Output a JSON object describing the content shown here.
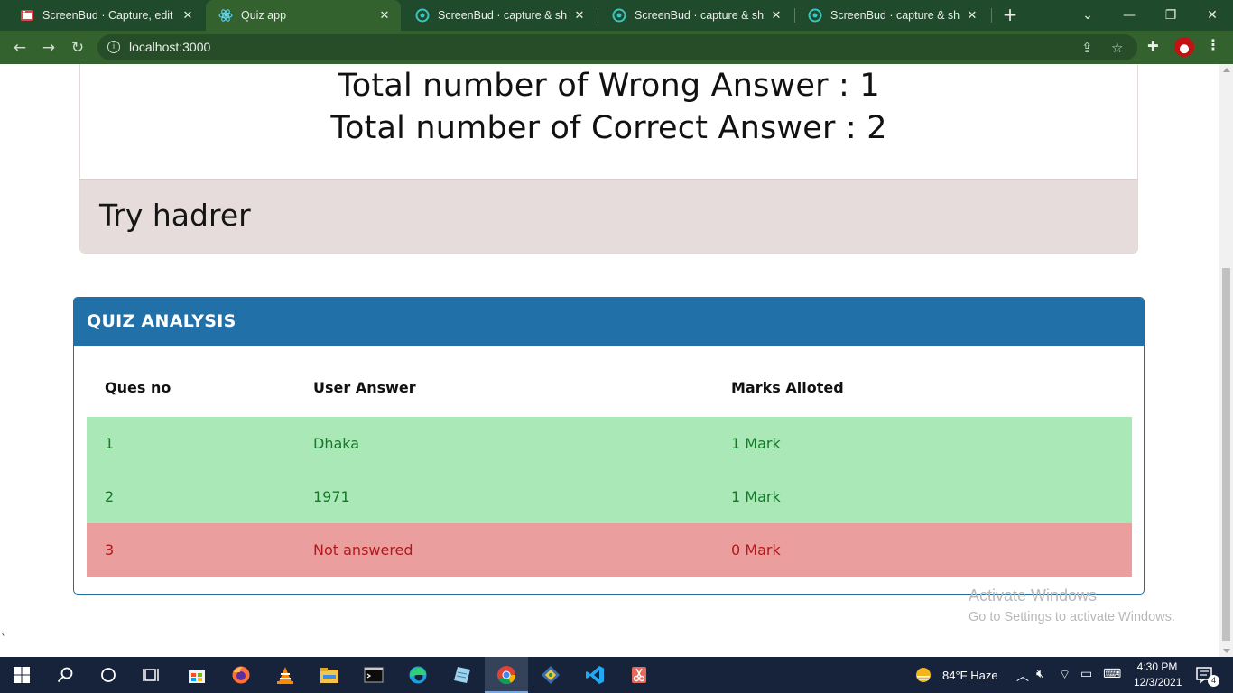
{
  "browser": {
    "tabs": [
      {
        "title": "ScreenBud · Capture, edit & s",
        "icon": "screenbud-red-icon",
        "active": false
      },
      {
        "title": "Quiz app",
        "icon": "react-icon",
        "active": true
      },
      {
        "title": "ScreenBud · capture & share",
        "icon": "screenbud-teal-icon",
        "active": false
      },
      {
        "title": "ScreenBud · capture & share",
        "icon": "screenbud-teal-icon",
        "active": false
      },
      {
        "title": "ScreenBud · capture & share",
        "icon": "screenbud-teal-icon",
        "active": false
      }
    ],
    "url": "localhost:3000"
  },
  "result": {
    "wrong_line": "Total number of Wrong Answer : 1",
    "correct_line": "Total number of Correct Answer : 2",
    "message": "Try hadrer"
  },
  "analysis": {
    "title": "QUIZ ANALYSIS",
    "headers": [
      "Ques no",
      "User Answer",
      "Marks Alloted"
    ],
    "rows": [
      {
        "no": "1",
        "answer": "Dhaka",
        "marks": "1 Mark",
        "status": "correct"
      },
      {
        "no": "2",
        "answer": "1971",
        "marks": "1 Mark",
        "status": "correct"
      },
      {
        "no": "3",
        "answer": "Not answered",
        "marks": "0 Mark",
        "status": "wrong"
      }
    ]
  },
  "watermark": {
    "line1": "Activate Windows",
    "line2": "Go to Settings to activate Windows."
  },
  "stray_char": "`",
  "taskbar": {
    "weather": "84°F  Haze",
    "time": "4:30 PM",
    "date": "12/3/2021",
    "notifications": "4"
  },
  "colors": {
    "chrome_dark": "#1f4a2b",
    "chrome_light": "#33622f",
    "analysis_header": "#2270a8",
    "row_correct": "#abe8b8",
    "row_wrong": "#eb9e9e",
    "text_correct": "#137a28",
    "text_wrong": "#b3191c",
    "result_footer": "#e6dcdc"
  }
}
